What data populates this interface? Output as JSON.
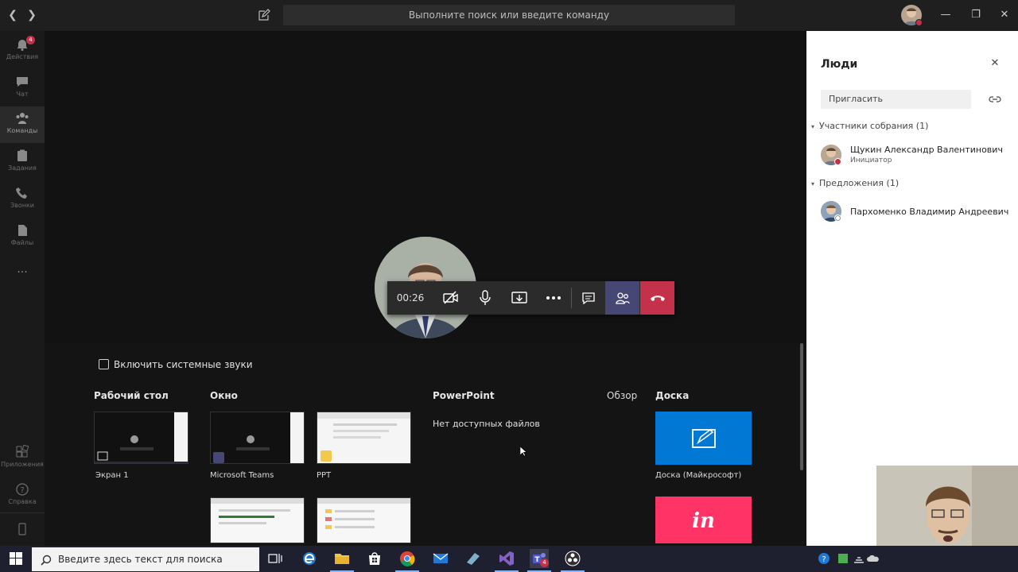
{
  "titlebar": {
    "search_placeholder": "Выполните поиск или введите команду"
  },
  "rail": {
    "items": [
      {
        "label": "Действия",
        "icon": "bell-icon",
        "badge": "4"
      },
      {
        "label": "Чат",
        "icon": "chat-icon"
      },
      {
        "label": "Команды",
        "icon": "teams-icon",
        "active": true
      },
      {
        "label": "Задания",
        "icon": "assignments-icon"
      },
      {
        "label": "Звонки",
        "icon": "phone-icon"
      },
      {
        "label": "Файлы",
        "icon": "files-icon"
      },
      {
        "label": "...",
        "icon": "more-icon"
      }
    ],
    "bottom": [
      {
        "label": "Приложения",
        "icon": "apps-icon"
      },
      {
        "label": "Справка",
        "icon": "help-icon"
      },
      {
        "label": "",
        "icon": "mobile-icon"
      }
    ]
  },
  "call": {
    "timer": "00:26",
    "accent_hangup": "#c4314b",
    "accent_active": "#464775"
  },
  "share_tray": {
    "system_sound_label": "Включить системные звуки",
    "desktop_header": "Рабочий стол",
    "window_header": "Окно",
    "powerpoint_header": "PowerPoint",
    "browse_label": "Обзор",
    "board_header": "Доска",
    "no_files": "Нет доступных файлов",
    "screen_label": "Экран 1",
    "teams_label": "Microsoft Teams",
    "ppt_label": "PPT",
    "whiteboard_label": "Доска (Майкрософт)",
    "whiteboard_color": "#0078d4",
    "invision_color": "#ff3366",
    "invision_text": "in"
  },
  "people": {
    "title": "Люди",
    "invite_placeholder": "Пригласить",
    "participants_header": "Участники собрания (1)",
    "participants": [
      {
        "name": "Щукин Александр Валентинович",
        "role": "Инициатор"
      }
    ],
    "suggestions_header": "Предложения (1)",
    "suggestions": [
      {
        "name": "Пархоменко Владимир Андреевич"
      }
    ]
  },
  "taskbar": {
    "search_placeholder": "Введите здесь текст для поиска",
    "teams_badge": "4"
  }
}
